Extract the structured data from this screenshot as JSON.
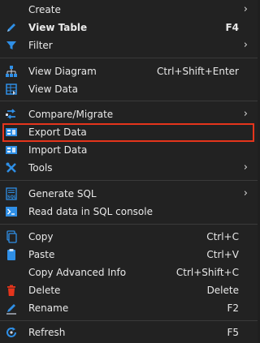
{
  "menu": {
    "items": [
      {
        "label": "Create",
        "shortcut": "",
        "submenu": true,
        "icon": "none"
      },
      {
        "label": "View Table",
        "shortcut": "F4",
        "submenu": false,
        "icon": "pencil-icon"
      },
      {
        "label": "Filter",
        "shortcut": "",
        "submenu": true,
        "icon": "filter-icon"
      },
      {
        "label": "View Diagram",
        "shortcut": "Ctrl+Shift+Enter",
        "submenu": false,
        "icon": "diagram-icon"
      },
      {
        "label": "View Data",
        "shortcut": "",
        "submenu": false,
        "icon": "data-icon"
      },
      {
        "label": "Compare/Migrate",
        "shortcut": "",
        "submenu": true,
        "icon": "compare-icon"
      },
      {
        "label": "Export Data",
        "shortcut": "",
        "submenu": false,
        "icon": "export-icon"
      },
      {
        "label": "Import Data",
        "shortcut": "",
        "submenu": false,
        "icon": "import-icon"
      },
      {
        "label": "Tools",
        "shortcut": "",
        "submenu": true,
        "icon": "tools-icon"
      },
      {
        "label": "Generate SQL",
        "shortcut": "",
        "submenu": true,
        "icon": "sql-icon"
      },
      {
        "label": "Read data in SQL console",
        "shortcut": "",
        "submenu": false,
        "icon": "console-icon"
      },
      {
        "label": "Copy",
        "shortcut": "Ctrl+C",
        "submenu": false,
        "icon": "copy-icon"
      },
      {
        "label": "Paste",
        "shortcut": "Ctrl+V",
        "submenu": false,
        "icon": "paste-icon"
      },
      {
        "label": "Copy Advanced Info",
        "shortcut": "Ctrl+Shift+C",
        "submenu": false,
        "icon": "none"
      },
      {
        "label": "Delete",
        "shortcut": "Delete",
        "submenu": false,
        "icon": "trash-icon"
      },
      {
        "label": "Rename",
        "shortcut": "F2",
        "submenu": false,
        "icon": "rename-icon"
      },
      {
        "label": "Refresh",
        "shortcut": "F5",
        "submenu": false,
        "icon": "refresh-icon"
      }
    ],
    "highlighted_item": "Export Data",
    "arrow_glyph": "›"
  },
  "colors": {
    "background": "#222222",
    "text": "#e9e9e9",
    "separator": "#3a3a3a",
    "highlight_border": "#e5351c",
    "icon_blue": "#2f8fe6"
  }
}
